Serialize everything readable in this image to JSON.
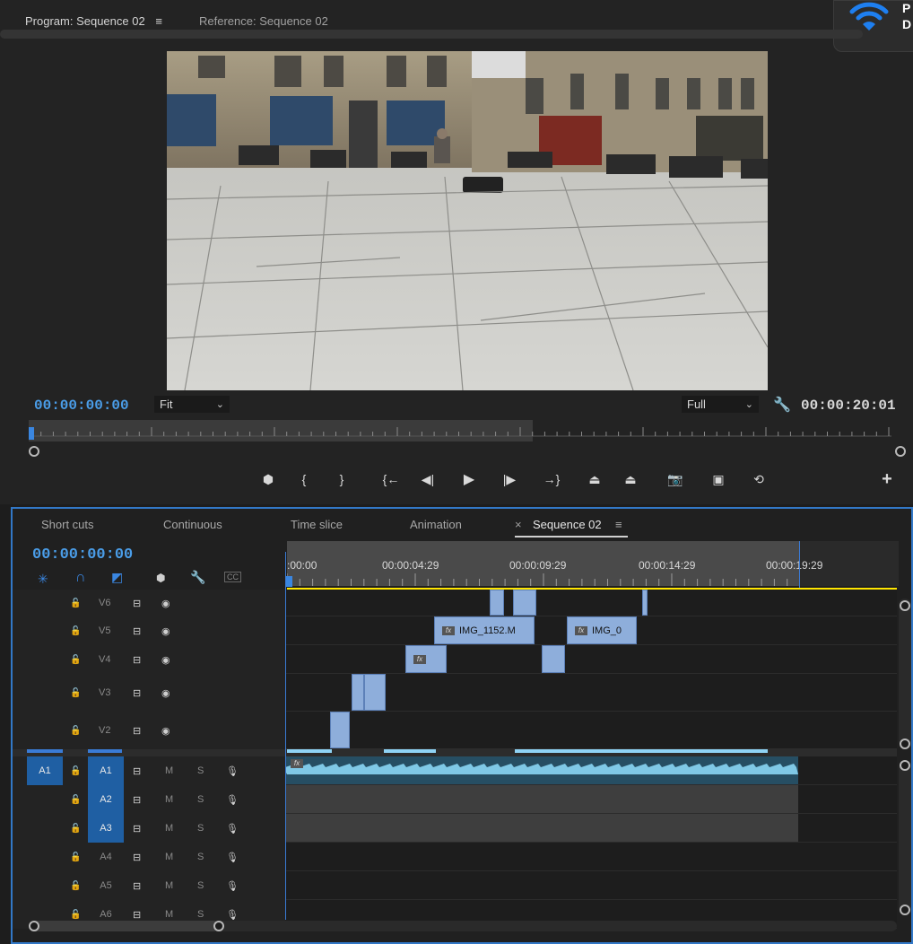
{
  "monitor": {
    "tab_program": "Program: Sequence 02",
    "tab_program_menu": "≡",
    "tab_reference": "Reference: Sequence 02",
    "wifi_letters": [
      "P",
      "D"
    ],
    "timecode_left": "00:00:00:00",
    "fit_label": "Fit",
    "full_label": "Full",
    "timecode_right": "00:00:20:01",
    "buttons": [
      {
        "name": "add-marker-button",
        "glyph": "⬢"
      },
      {
        "name": "mark-in-button",
        "glyph": "{"
      },
      {
        "name": "mark-out-button",
        "glyph": "}"
      },
      {
        "name": "go-to-in-button",
        "glyph": "{←"
      },
      {
        "name": "step-back-button",
        "glyph": "◀|"
      },
      {
        "name": "play-button",
        "glyph": "▶"
      },
      {
        "name": "step-forward-button",
        "glyph": "|▶"
      },
      {
        "name": "go-to-out-button",
        "glyph": "→}"
      },
      {
        "name": "lift-button",
        "glyph": "⏏"
      },
      {
        "name": "extract-button",
        "glyph": "⏏"
      },
      {
        "name": "export-frame-button",
        "glyph": "📷"
      },
      {
        "name": "insert-button",
        "glyph": "▣"
      },
      {
        "name": "overwrite-button",
        "glyph": "⟲"
      },
      {
        "name": "add-button",
        "glyph": "+"
      }
    ]
  },
  "timeline": {
    "tabs": [
      "Short cuts",
      "Continuous",
      "Time slice",
      "Animation",
      "Sequence 02"
    ],
    "tab_close": "×",
    "tab_menu": "≡",
    "timecode": "00:00:00:00",
    "ruler_labels": [
      ":00:00",
      "00:00:04:29",
      "00:00:09:29",
      "00:00:14:29",
      "00:00:19:29"
    ],
    "video_tracks": [
      "V6",
      "V5",
      "V4",
      "V3",
      "V2"
    ],
    "audio_tracks": [
      "A1",
      "A2",
      "A3",
      "A4",
      "A5",
      "A6"
    ],
    "source_patch": "A1",
    "mute": "M",
    "solo": "S",
    "clip_v5_a": "IMG_1152.M",
    "clip_v5_b": "IMG_0",
    "fx": "fx",
    "cc": "CC"
  },
  "colors": {
    "accent": "#3278c7",
    "clip": "#8eaedb",
    "audio_wave": "#7fc8e6",
    "yellow": "#ffe600"
  }
}
